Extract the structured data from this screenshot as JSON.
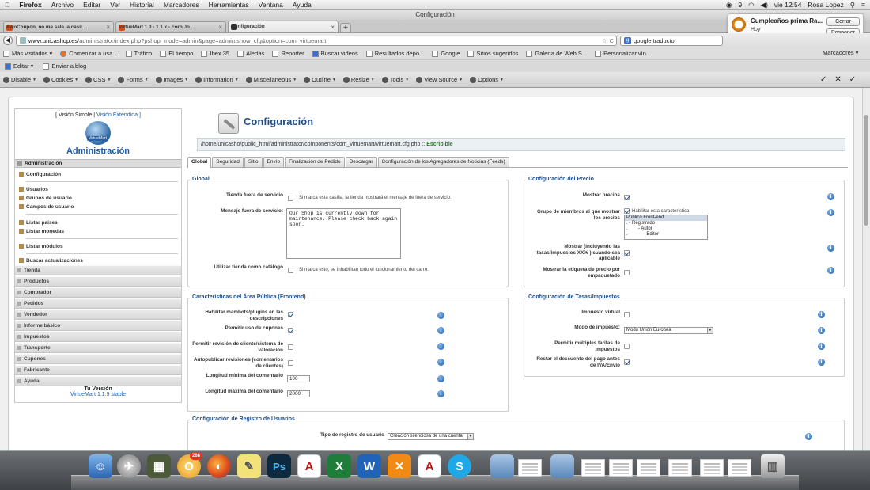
{
  "menubar": {
    "app": "Firefox",
    "items": [
      "Archivo",
      "Editar",
      "Ver",
      "Historial",
      "Marcadores",
      "Herramientas",
      "Ventana",
      "Ayuda"
    ],
    "battery": "9",
    "clock": "vie 12:54",
    "user": "Rosa Lopez"
  },
  "window_title": "Configuración",
  "tabs": [
    {
      "label": "AwoCoupon, no me sale la casil...",
      "close": "×",
      "color": "#d44a1a"
    },
    {
      "label": "VirtueMart 1.0 - 1.1.x - Foro Jo...",
      "close": "×",
      "color": "#d44a1a"
    },
    {
      "label": "Configuración",
      "close": "×",
      "color": "#333333"
    }
  ],
  "new_tab": "+",
  "notification": {
    "title": "Cumpleaños prima Ra...",
    "subtitle": "Hoy",
    "close": "Cerrar",
    "postpone": "Posponer"
  },
  "urlbar": {
    "domain": "www.unicashop.es",
    "path": "/administrator/index.php?pshop_mode=admin&page=admin.show_cfg&option=com_virtuemart",
    "search_value": "google traductor",
    "back": "◀",
    "star": "☆",
    "reload": "C"
  },
  "bookmarks": [
    "Más visitados ▾",
    "Comenzar a usa...",
    "Tráfico",
    "El tiempo",
    "Ibex 35",
    "Alertas",
    "Reporter",
    "Buscar videos",
    "Resultados depo...",
    "Google",
    "Sitios sugeridos",
    "Galería de Web S...",
    "Personalizar vín..."
  ],
  "bookmarks_right": "Marcadores ▾",
  "blogbar": [
    "Editar ▾",
    "Enviar a blog"
  ],
  "devbar": [
    "Disable",
    "Cookies",
    "CSS",
    "Forms",
    "Images",
    "Information",
    "Miscellaneous",
    "Outline",
    "Resize",
    "Tools",
    "View Source",
    "Options"
  ],
  "devbar_right": [
    "✓",
    "✕",
    "✓"
  ],
  "sidebar": {
    "view_simple": "[ Visión Simple",
    "view_sep": "|",
    "view_extended": "Visión Extendida ]",
    "logo_text": "VirtueMart",
    "title": "Administración",
    "head": "Administración",
    "items": [
      "Configuración",
      "Usuarios",
      "Grupos de usuario",
      "Campos de usuario",
      "Listar países",
      "Listar monedas",
      "Listar módulos",
      "Buscar actualizaciones"
    ],
    "grey_items": [
      "Tienda",
      "Productos",
      "Comprador",
      "Pedidos",
      "Vendedor",
      "Informe básico",
      "Impuestos",
      "Transporte",
      "Cupones",
      "Fabricante",
      "Ayuda"
    ],
    "version_label": "Tu Versión",
    "version": "VirtueMart 1.1.9 stable"
  },
  "header": {
    "title": "Configuración",
    "path": "/home/unicasho/public_html/administrator/components/com_virtuemart/virtuemart.cfg.php ::",
    "writable": "Escribible"
  },
  "content_tabs": [
    "Global",
    "Seguridad",
    "Sitio",
    "Envío",
    "Finalización de Pedido",
    "Descargar",
    "Configuración de los Agregadores de Noticias (Feeds)"
  ],
  "global": {
    "legend": "Global",
    "offline_label": "Tienda fuera de servicio",
    "offline_hint": "Si marca esta casilla, la tienda mostrará el mensaje de fuera de servicio.",
    "offline_msg_label": "Mensaje fuera de servicio:",
    "offline_msg": "Our Shop is currently down for\nmaintenance. Please check back again\nsoon.",
    "catalog_label": "Utilizar tienda como catálogo",
    "catalog_hint": "Si marca esto, se inhabilitan todo el funcionamiento del carro."
  },
  "price": {
    "legend": "Configuración del Precio",
    "show_prices": "Mostrar precios",
    "group_label": "Grupo de miembros al que mostrar los precios",
    "enable_feature": "Habilitar esta característica",
    "groups": [
      "Público Front-end",
      ". - Registrado",
      ".        - Autor",
      ".            - Editor"
    ],
    "incl_tax": "Mostrar (incluyendo las tasas/impuestos XX% ) cuando sea aplicable",
    "packaged": "Mostrar la etiqueta de precio por empaquetado"
  },
  "frontend": {
    "legend": "Características del Área Pública (Frontend)",
    "mambots": "Habilitar mambots/plugins en las descripciones",
    "coupons": "Permitir uso de cupones",
    "reviews": "Permitir revisión de cliente/sistema de valoración",
    "autopublish": "Autopublicar revisiones (comentarios de clientes)",
    "min_label": "Longitud mínima del comentario",
    "min_value": "100",
    "max_label": "Longitud máxima del comentario",
    "max_value": "2000"
  },
  "tax": {
    "legend": "Configuración de Tasas/Impuestos",
    "virtual": "Impuesto virtual",
    "mode_label": "Modo de impuesto:",
    "mode_value": "Modo Unión Europea",
    "multiple": "Permitir múltiples tarifas de impuestos",
    "discount": "Restar el descuento del pago antes de IVA/Envío"
  },
  "registration": {
    "legend": "Configuración de Registro de Usuarios",
    "type_label": "Tipo de registro de usuario",
    "type_value": "Creación silenciosa de una cuenta"
  },
  "info_glyph": "i",
  "dock_badge": "268"
}
